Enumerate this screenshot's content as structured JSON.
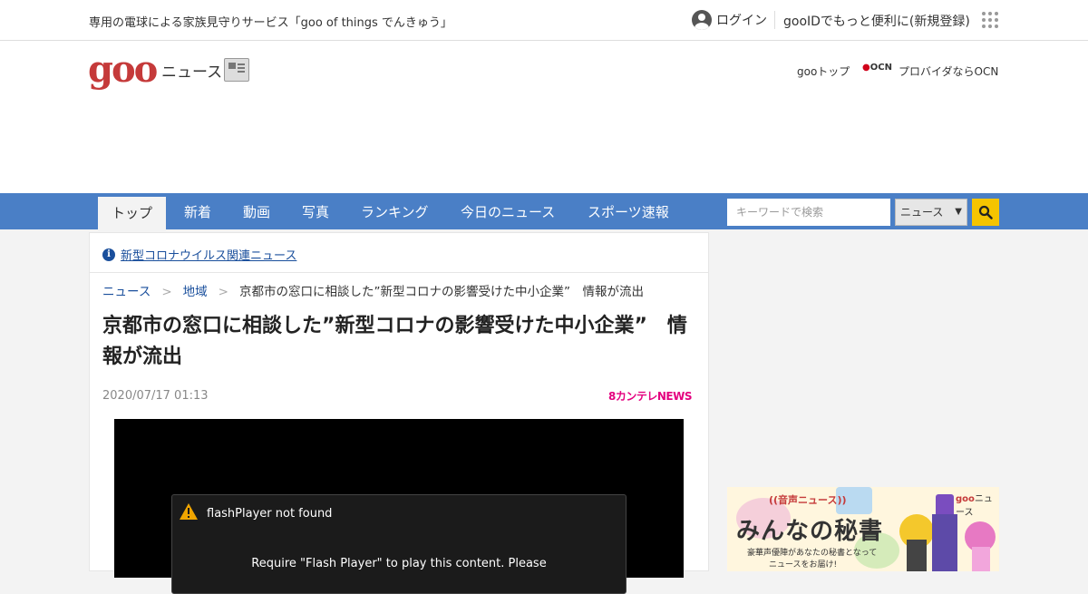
{
  "topbar": {
    "promo": "専用の電球による家族見守りサービス「goo of things でんきゅう」",
    "login": "ログイン",
    "register": "gooIDでもっと便利に(新規登録)"
  },
  "header": {
    "logo": "goo",
    "logo_sub": "ニュース",
    "goo_top": "gooトップ",
    "ocn_badge": "OCN",
    "ocn_text": "プロバイダならOCN"
  },
  "nav": {
    "tabs": [
      "トップ",
      "新着",
      "動画",
      "写真",
      "ランキング",
      "今日のニュース",
      "スポーツ速報"
    ],
    "active": "トップ",
    "search_placeholder": "キーワードで検索",
    "search_scope": "ニュース"
  },
  "notice": {
    "link": "新型コロナウイルス関連ニュース"
  },
  "breadcrumb": {
    "items": [
      "ニュース",
      "地域",
      "京都市の窓口に相談した”新型コロナの影響受けた中小企業”　情報が流出"
    ]
  },
  "article": {
    "title": "京都市の窓口に相談した”新型コロナの影響受けた中小企業”　情報が流出",
    "date": "2020/07/17 01:13",
    "source": "8カンテレNEWS"
  },
  "player": {
    "error_title": "flashPlayer not found",
    "error_message": "Require \"Flash Player\" to play this content. Please"
  },
  "ad": {
    "subtitle": "((音声ニュース))",
    "title": "みんなの秘書",
    "desc1": "豪華声優陣があなたの秘書となって",
    "desc2": "ニュースをお届け!",
    "brand": "goo",
    "brand_suffix": "ニュース"
  },
  "colors": {
    "nav_bg": "#4a7fc6",
    "logo_red": "#c53a3a",
    "link_blue": "#1a4f9c",
    "search_button": "#f5c400",
    "kantele_pink": "#e4007f"
  },
  "icons": [
    "user-avatar-icon",
    "app-grid-icon",
    "newspaper-icon",
    "search-icon",
    "info-icon",
    "warning-icon"
  ]
}
